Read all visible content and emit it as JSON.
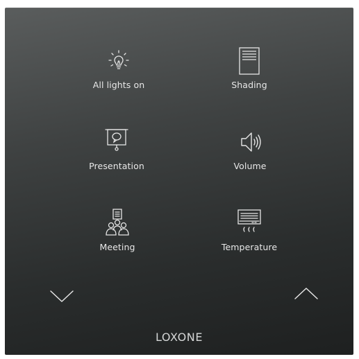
{
  "buttons": [
    {
      "label": "All lights on",
      "icon": "lightbulb-icon"
    },
    {
      "label": "Shading",
      "icon": "blinds-icon"
    },
    {
      "label": "Presentation",
      "icon": "projector-screen-icon"
    },
    {
      "label": "Volume",
      "icon": "speaker-icon"
    },
    {
      "label": "Meeting",
      "icon": "meeting-people-icon"
    },
    {
      "label": "Temperature",
      "icon": "air-conditioner-icon"
    }
  ],
  "navigation": {
    "down_icon": "chevron-down-icon",
    "up_icon": "chevron-up-icon"
  },
  "brand": {
    "name": "LOXONE"
  },
  "colors": {
    "panel_top": "#5a5d5d",
    "panel_bottom": "#1e2020",
    "foreground": "#e6e6e6"
  }
}
